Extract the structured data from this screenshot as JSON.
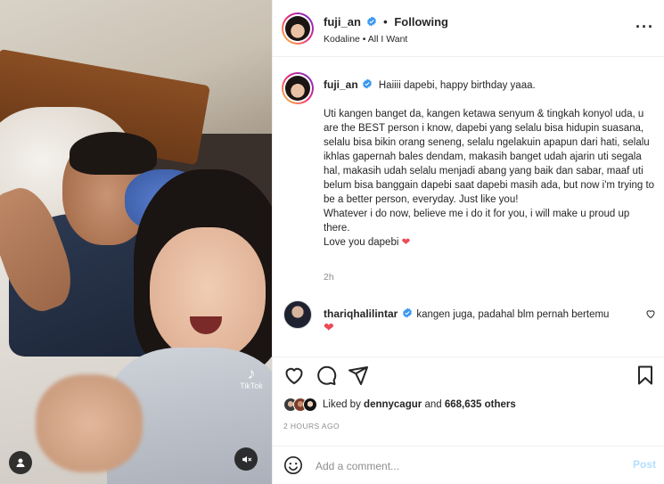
{
  "media": {
    "watermark": "TikTok"
  },
  "header": {
    "username": "fuji_an",
    "separator": "•",
    "follow_status": "Following",
    "audio": "Kodaline • All I Want",
    "more_icon": "more-horizontal-icon"
  },
  "caption": {
    "username": "fuji_an",
    "first_line": "Haiiii dapebi, happy birthday yaaa.",
    "paragraph": "Uti kangen banget da, kangen ketawa senyum & tingkah konyol uda, u are the BEST person i know, dapebi yang selalu bisa hidupin suasana, selalu bisa bikin orang seneng, selalu ngelakuin apapun dari hati, selalu ikhlas gapernah bales dendam, makasih banget udah ajarin uti segala hal, makasih udah selalu menjadi abang yang baik dan sabar, maaf uti belum bisa banggain dapebi saat dapebi masih ada, but now i'm trying to be a better person, everyday. Just like you!",
    "line_whatever": "Whatever i do now, believe me i do it for you, i will make u proud up there.",
    "line_love": "Love you dapebi",
    "heart": "❤",
    "time": "2h"
  },
  "comment": {
    "username": "thariqhalilintar",
    "text": "kangen juga, padahal blm pernah bertemu",
    "heart": "❤"
  },
  "actions": {
    "liked_prefix": "Liked by",
    "liked_user": "dennycagur",
    "liked_and": "and",
    "liked_count": "668,635 others",
    "timestamp": "2 HOURS AGO"
  },
  "add_comment": {
    "placeholder": "Add a comment...",
    "post_label": "Post"
  },
  "colors": {
    "verified": "#3897f0",
    "heart": "#ed4956",
    "post_disabled": "#b2dffc",
    "muted_text": "#8e8e8e"
  }
}
